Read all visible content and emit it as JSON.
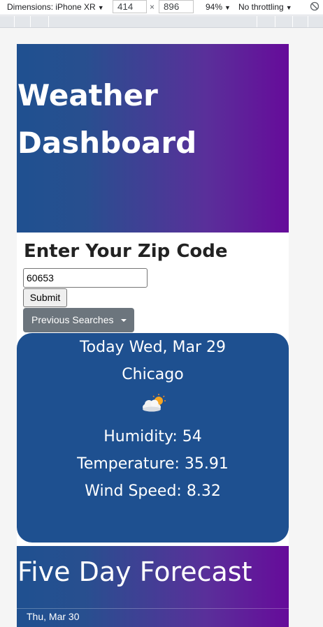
{
  "devtools": {
    "dimensions_label": "Dimensions: iPhone XR",
    "width_value": "414",
    "height_value": "896",
    "times": "×",
    "zoom": "94%",
    "throttling": "No throttling"
  },
  "page": {
    "title": "Weather Dashboard",
    "zip_heading": "Enter Your Zip Code",
    "zip_value": "60653",
    "submit_label": "Submit",
    "previous_searches_label": "Previous Searches",
    "today": {
      "date_line": "Today Wed, Mar 29",
      "city": "Chicago",
      "weather_icon": "partly-cloudy-icon",
      "humidity_line": "Humidity: 54",
      "temperature_line": "Temperature: 35.91",
      "wind_line": "Wind Speed: 8.32"
    },
    "forecast": {
      "title": "Five Day Forecast",
      "days": [
        "Thu, Mar 30"
      ]
    }
  },
  "colors": {
    "card_blue": "#1e5090",
    "gradient_start": "#1f5090",
    "gradient_end": "#660b9a",
    "secondary_button": "#6c757d"
  }
}
